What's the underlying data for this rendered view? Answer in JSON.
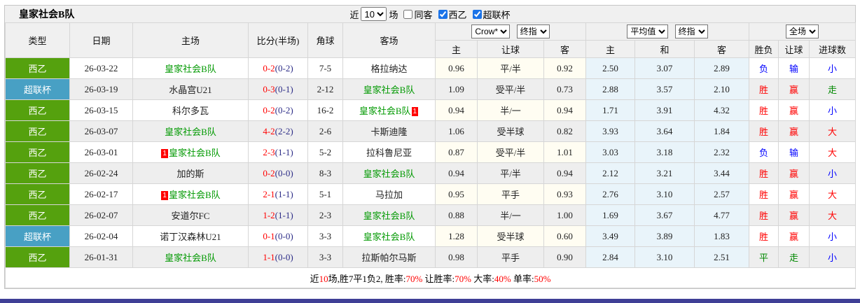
{
  "title": "皇家社会B队",
  "controls": {
    "near_label": "近",
    "match_count": "10",
    "unit_label": "场",
    "filters": [
      {
        "label": "同客",
        "checked": false
      },
      {
        "label": "西乙",
        "checked": true
      },
      {
        "label": "超联杯",
        "checked": true
      }
    ]
  },
  "selects": {
    "odds_company": "Crow*",
    "odds_time_1": "终指",
    "average": "平均值",
    "odds_time_2": "终指",
    "scope": "全场"
  },
  "columns": {
    "type": "类型",
    "date": "日期",
    "home": "主场",
    "score": "比分(半场)",
    "corner": "角球",
    "away": "客场",
    "crow_home": "主",
    "crow_handicap": "让球",
    "crow_away": "客",
    "avg_home": "主",
    "avg_draw": "和",
    "avg_away": "客",
    "result": "胜负",
    "handicap_result": "让球",
    "goals": "进球数"
  },
  "colors": {
    "win": "#ff0000",
    "loss": "#0000ff",
    "draw": "#008800",
    "type_green": "#55a10e",
    "type_blue": "#48a0c4",
    "self_team": "#009900"
  },
  "rows": [
    {
      "type": "西乙",
      "type_color": "type_green",
      "date": "26-03-22",
      "home": {
        "name": "皇家社会B队",
        "self": true
      },
      "score_full": "0-2",
      "score_half": "(0-2)",
      "corner": "7-5",
      "away": {
        "name": "格拉纳达",
        "self": false
      },
      "odds": [
        "0.96",
        "平/半",
        "0.92"
      ],
      "avg": [
        "2.50",
        "3.07",
        "2.89"
      ],
      "result": {
        "text": "负",
        "color": "loss"
      },
      "handicap": {
        "text": "输",
        "color": "loss"
      },
      "goals": {
        "text": "小",
        "color": "loss"
      }
    },
    {
      "type": "超联杯",
      "type_color": "type_blue",
      "date": "26-03-19",
      "home": {
        "name": "水晶宫U21",
        "self": false
      },
      "score_full": "0-3",
      "score_half": "(0-1)",
      "corner": "2-12",
      "away": {
        "name": "皇家社会B队",
        "self": true
      },
      "odds": [
        "1.09",
        "受平/半",
        "0.73"
      ],
      "avg": [
        "2.88",
        "3.57",
        "2.10"
      ],
      "result": {
        "text": "胜",
        "color": "win"
      },
      "handicap": {
        "text": "赢",
        "color": "win"
      },
      "goals": {
        "text": "走",
        "color": "draw"
      }
    },
    {
      "type": "西乙",
      "type_color": "type_green",
      "date": "26-03-15",
      "home": {
        "name": "科尔多瓦",
        "self": false
      },
      "score_full": "0-2",
      "score_half": "(0-2)",
      "corner": "16-2",
      "away": {
        "name": "皇家社会B队",
        "self": true,
        "badge_after": true,
        "badge": "1"
      },
      "odds": [
        "0.94",
        "半/一",
        "0.94"
      ],
      "avg": [
        "1.71",
        "3.91",
        "4.32"
      ],
      "result": {
        "text": "胜",
        "color": "win"
      },
      "handicap": {
        "text": "赢",
        "color": "win"
      },
      "goals": {
        "text": "小",
        "color": "loss"
      }
    },
    {
      "type": "西乙",
      "type_color": "type_green",
      "date": "26-03-07",
      "home": {
        "name": "皇家社会B队",
        "self": true
      },
      "score_full": "4-2",
      "score_half": "(2-2)",
      "corner": "2-6",
      "away": {
        "name": "卡斯迪隆",
        "self": false
      },
      "odds": [
        "1.06",
        "受半球",
        "0.82"
      ],
      "avg": [
        "3.93",
        "3.64",
        "1.84"
      ],
      "result": {
        "text": "胜",
        "color": "win"
      },
      "handicap": {
        "text": "赢",
        "color": "win"
      },
      "goals": {
        "text": "大",
        "color": "win"
      }
    },
    {
      "type": "西乙",
      "type_color": "type_green",
      "date": "26-03-01",
      "home": {
        "name": "皇家社会B队",
        "self": true,
        "badge_before": true,
        "badge": "1"
      },
      "score_full": "2-3",
      "score_half": "(1-1)",
      "corner": "5-2",
      "away": {
        "name": "拉科鲁尼亚",
        "self": false
      },
      "odds": [
        "0.87",
        "受平/半",
        "1.01"
      ],
      "avg": [
        "3.03",
        "3.18",
        "2.32"
      ],
      "result": {
        "text": "负",
        "color": "loss"
      },
      "handicap": {
        "text": "输",
        "color": "loss"
      },
      "goals": {
        "text": "大",
        "color": "win"
      }
    },
    {
      "type": "西乙",
      "type_color": "type_green",
      "date": "26-02-24",
      "home": {
        "name": "加的斯",
        "self": false
      },
      "score_full": "0-2",
      "score_half": "(0-0)",
      "corner": "8-3",
      "away": {
        "name": "皇家社会B队",
        "self": true
      },
      "odds": [
        "0.94",
        "平/半",
        "0.94"
      ],
      "avg": [
        "2.12",
        "3.21",
        "3.44"
      ],
      "result": {
        "text": "胜",
        "color": "win"
      },
      "handicap": {
        "text": "赢",
        "color": "win"
      },
      "goals": {
        "text": "小",
        "color": "loss"
      }
    },
    {
      "type": "西乙",
      "type_color": "type_green",
      "date": "26-02-17",
      "home": {
        "name": "皇家社会B队",
        "self": true,
        "badge_before": true,
        "badge": "1"
      },
      "score_full": "2-1",
      "score_half": "(1-1)",
      "corner": "5-1",
      "away": {
        "name": "马拉加",
        "self": false
      },
      "odds": [
        "0.95",
        "平手",
        "0.93"
      ],
      "avg": [
        "2.76",
        "3.10",
        "2.57"
      ],
      "result": {
        "text": "胜",
        "color": "win"
      },
      "handicap": {
        "text": "赢",
        "color": "win"
      },
      "goals": {
        "text": "大",
        "color": "win"
      }
    },
    {
      "type": "西乙",
      "type_color": "type_green",
      "date": "26-02-07",
      "home": {
        "name": "安道尔FC",
        "self": false
      },
      "score_full": "1-2",
      "score_half": "(1-1)",
      "corner": "2-3",
      "away": {
        "name": "皇家社会B队",
        "self": true
      },
      "odds": [
        "0.88",
        "半/一",
        "1.00"
      ],
      "avg": [
        "1.69",
        "3.67",
        "4.77"
      ],
      "result": {
        "text": "胜",
        "color": "win"
      },
      "handicap": {
        "text": "赢",
        "color": "win"
      },
      "goals": {
        "text": "大",
        "color": "win"
      }
    },
    {
      "type": "超联杯",
      "type_color": "type_blue",
      "date": "26-02-04",
      "home": {
        "name": "诺丁汉森林U21",
        "self": false
      },
      "score_full": "0-1",
      "score_half": "(0-0)",
      "corner": "3-3",
      "away": {
        "name": "皇家社会B队",
        "self": true
      },
      "odds": [
        "1.28",
        "受半球",
        "0.60"
      ],
      "avg": [
        "3.49",
        "3.89",
        "1.83"
      ],
      "result": {
        "text": "胜",
        "color": "win"
      },
      "handicap": {
        "text": "赢",
        "color": "win"
      },
      "goals": {
        "text": "小",
        "color": "loss"
      }
    },
    {
      "type": "西乙",
      "type_color": "type_green",
      "date": "26-01-31",
      "home": {
        "name": "皇家社会B队",
        "self": true
      },
      "score_full": "1-1",
      "score_half": "(0-0)",
      "corner": "3-3",
      "away": {
        "name": "拉斯帕尔马斯",
        "self": false
      },
      "odds": [
        "0.98",
        "平手",
        "0.90"
      ],
      "avg": [
        "2.84",
        "3.10",
        "2.51"
      ],
      "result": {
        "text": "平",
        "color": "draw"
      },
      "handicap": {
        "text": "走",
        "color": "draw"
      },
      "goals": {
        "text": "小",
        "color": "loss"
      }
    }
  ],
  "footer_segments": [
    {
      "text": "近",
      "red": false
    },
    {
      "text": "10",
      "red": true
    },
    {
      "text": "场,胜7平1负2, 胜率:",
      "red": false
    },
    {
      "text": "70%",
      "red": true
    },
    {
      "text": " 让胜率:",
      "red": false
    },
    {
      "text": "70%",
      "red": true
    },
    {
      "text": " 大率:",
      "red": false
    },
    {
      "text": "40%",
      "red": true
    },
    {
      "text": " 单率:",
      "red": false
    },
    {
      "text": "50%",
      "red": true
    }
  ]
}
